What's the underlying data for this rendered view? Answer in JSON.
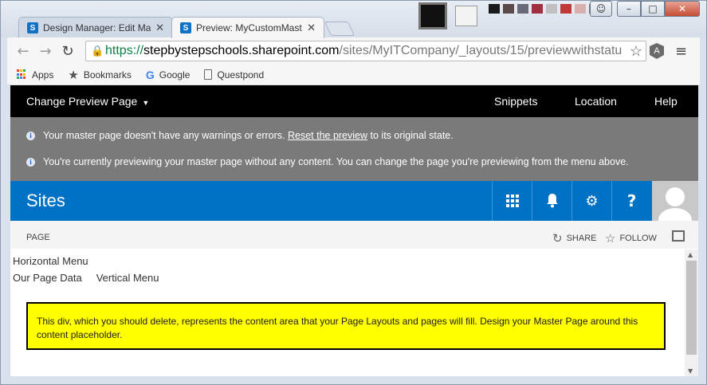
{
  "browser": {
    "tabs": [
      {
        "title": "Design Manager: Edit Mas",
        "active": false
      },
      {
        "title": "Preview: MyCustomMaste",
        "active": true
      }
    ],
    "url": {
      "scheme": "https://",
      "host": "stepbystepschools.sharepoint.com",
      "path": "/sites/MyITCompany/_layouts/15/previewwithstatu"
    },
    "bookmarks": [
      {
        "label": "Apps",
        "icon": "apps-grid-icon"
      },
      {
        "label": "Bookmarks",
        "icon": "star-icon"
      },
      {
        "label": "Google",
        "icon": "google-icon"
      },
      {
        "label": "Questpond",
        "icon": "document-icon"
      }
    ],
    "ext_icon_letter": "A"
  },
  "sp": {
    "topbar": {
      "preview_menu": "Change Preview Page",
      "links": [
        "Snippets",
        "Location",
        "Help"
      ]
    },
    "status": {
      "line1_prefix": "Your master page doesn't have any warnings or errors.",
      "line1_link": "Reset the preview",
      "line1_suffix": "to its original state.",
      "line2": "You're currently previewing your master page without any content. You can change the page you're previewing from the menu above."
    },
    "suite": {
      "title": "Sites"
    },
    "ribbon": {
      "page_tab": "PAGE",
      "share": "SHARE",
      "follow": "FOLLOW"
    },
    "content": {
      "horizontal_menu": "Horizontal Menu",
      "our_page_data": "Our Page Data",
      "vertical_menu": "Vertical Menu",
      "placeholder_text": "This div, which you should delete, represents the content area that your Page Layouts and pages will fill. Design your Master Page around this content placeholder."
    }
  },
  "colors": {
    "suite_blue": "#0072c6",
    "status_gray": "#7a7a7a",
    "placeholder_yellow": "#ffff00",
    "topbar_black": "#000000"
  }
}
